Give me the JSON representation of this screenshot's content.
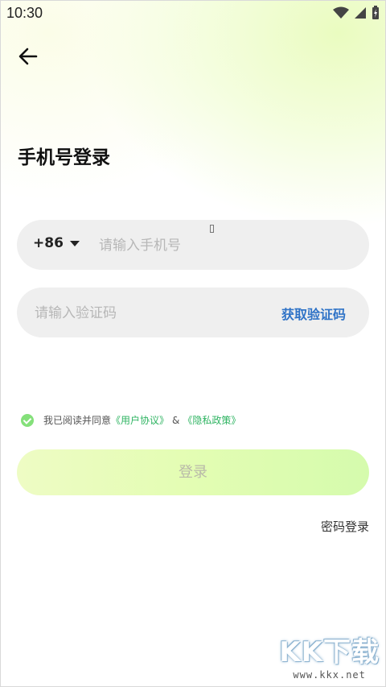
{
  "status_bar": {
    "time": "10:30"
  },
  "page": {
    "title": "手机号登录"
  },
  "phone_field": {
    "country_code": "+86",
    "placeholder": "请输入手机号",
    "value": ""
  },
  "code_field": {
    "placeholder": "请输入验证码",
    "value": "",
    "get_code_label": "获取验证码"
  },
  "agreement": {
    "prefix": "我已阅读并同意",
    "user_agreement": "《用户协议》",
    "separator": "&",
    "privacy_policy": "《隐私政策》",
    "checked": true
  },
  "login_button": {
    "label": "登录"
  },
  "password_login": {
    "label": "密码登录"
  },
  "watermark": {
    "text": "KK下载",
    "url": "www.kkx.net"
  },
  "colors": {
    "accent_link": "#2f73c7",
    "agreement_link": "#2fb462",
    "check": "#84e07a"
  }
}
